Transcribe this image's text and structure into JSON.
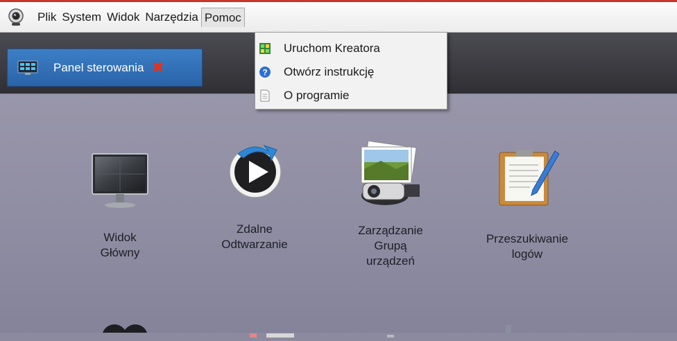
{
  "menubar": {
    "items": [
      "Plik",
      "System",
      "Widok",
      "Narzędzia",
      "Pomoc"
    ]
  },
  "tab": {
    "label": "Panel sterowania",
    "close_glyph": "✖"
  },
  "dropdown": {
    "items": [
      {
        "label": "Uruchom Kreatora",
        "icon": "wizard-grid-icon"
      },
      {
        "label": "Otwórz instrukcję",
        "icon": "help-question-icon"
      },
      {
        "label": "O programie",
        "icon": "document-icon"
      }
    ]
  },
  "tiles": [
    {
      "line1": "Widok",
      "line2": "Główny",
      "line3": "",
      "icon": "monitor-icon"
    },
    {
      "line1": "Zdalne",
      "line2": "Odtwarzanie",
      "line3": "",
      "icon": "playback-icon"
    },
    {
      "line1": "Zarządzanie",
      "line2": "Grupą",
      "line3": "urządzeń",
      "icon": "device-group-icon"
    },
    {
      "line1": "Przeszukiwanie",
      "line2": "logów",
      "line3": "",
      "icon": "log-search-icon"
    }
  ],
  "colors": {
    "tab_active": "#2f6bb0",
    "close_red": "#e0331f",
    "background": "#8c8a9e"
  }
}
